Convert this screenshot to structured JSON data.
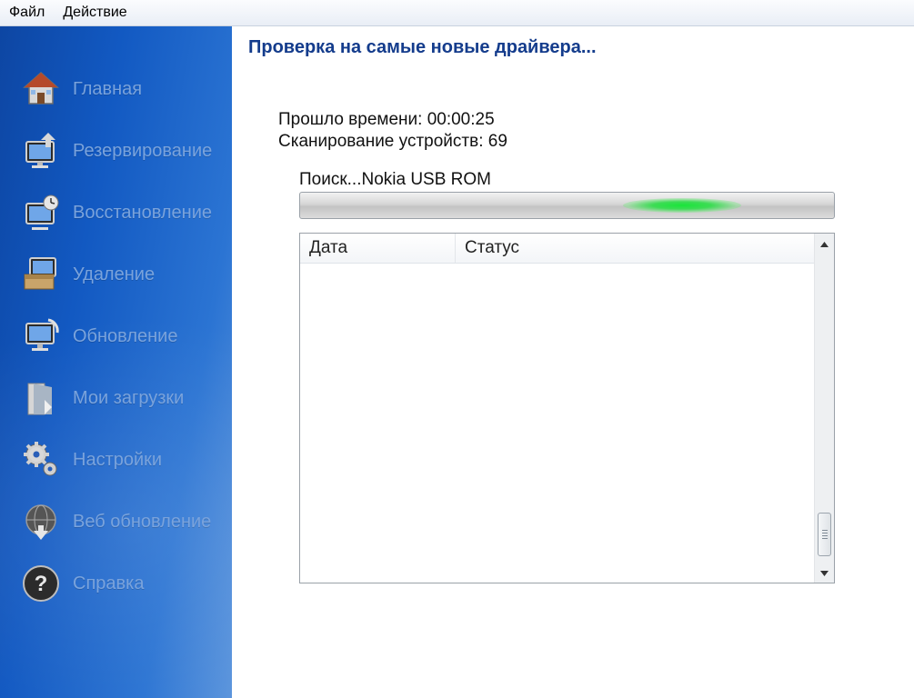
{
  "menu": {
    "items": [
      "Файл",
      "Действие"
    ]
  },
  "sidebar": {
    "items": [
      {
        "label": "Главная",
        "icon": "home-icon"
      },
      {
        "label": "Резервирование",
        "icon": "backup-icon"
      },
      {
        "label": "Восстановление",
        "icon": "restore-icon"
      },
      {
        "label": "Удаление",
        "icon": "uninstall-icon"
      },
      {
        "label": "Обновление",
        "icon": "update-icon"
      },
      {
        "label": "Мои загрузки",
        "icon": "downloads-icon"
      },
      {
        "label": "Настройки",
        "icon": "settings-icon"
      },
      {
        "label": "Веб обновление",
        "icon": "web-update-icon"
      },
      {
        "label": "Справка",
        "icon": "help-icon"
      }
    ]
  },
  "main": {
    "title": "Проверка на самые новые драйвера...",
    "elapsed": "Прошло времени: 00:00:25",
    "scanned": "Сканирование устройств: 69",
    "search_label": "Поиск...Nokia USB ROM",
    "progress_state": "indeterminate",
    "progress_color": "#1fe03c",
    "table": {
      "columns": [
        "Дата",
        "Статус"
      ],
      "rows": []
    }
  }
}
